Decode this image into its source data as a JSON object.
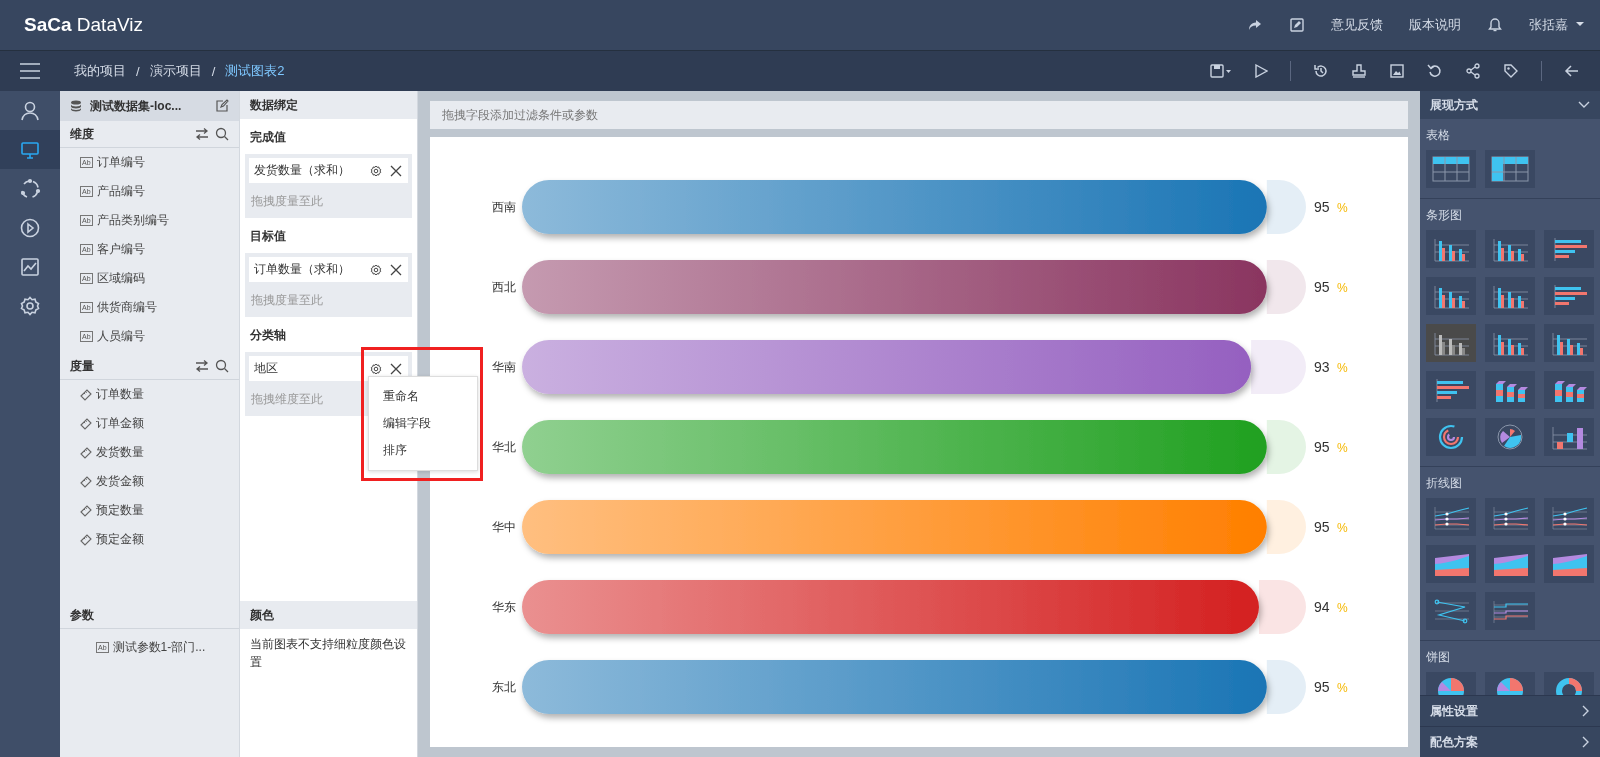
{
  "header": {
    "logo_mark": "SaCa",
    "logo_text": "DataViz",
    "links": [
      "意见反馈",
      "版本说明"
    ],
    "user": "张括嘉"
  },
  "breadcrumb": {
    "items": [
      {
        "label": "我的项目",
        "current": false
      },
      {
        "label": "演示项目",
        "current": false
      },
      {
        "label": "测试图表2",
        "current": true
      }
    ],
    "separators": [
      "/",
      "/"
    ]
  },
  "nav_rail": [
    {
      "kind": "user",
      "selected": false
    },
    {
      "kind": "monitor",
      "selected": true
    },
    {
      "kind": "cycle",
      "selected": false
    },
    {
      "kind": "play",
      "selected": false
    },
    {
      "kind": "trend",
      "selected": false
    },
    {
      "kind": "settings",
      "selected": false
    }
  ],
  "dataset": {
    "title": "测试数据集-loc..."
  },
  "dimensions": {
    "title": "维度",
    "items": [
      {
        "badge": "Ab",
        "label": "订单编号"
      },
      {
        "badge": "Ab",
        "label": "产品编号"
      },
      {
        "badge": "Ab",
        "label": "产品类别编号"
      },
      {
        "badge": "Ab",
        "label": "客户编号"
      },
      {
        "badge": "Ab",
        "label": "区域编码"
      },
      {
        "badge": "Ab",
        "label": "供货商编号"
      },
      {
        "badge": "Ab",
        "label": "人员编号"
      }
    ]
  },
  "measures": {
    "title": "度量",
    "items": [
      "订单数量",
      "订单金额",
      "发货数量",
      "发货金额",
      "预定数量",
      "预定金额"
    ]
  },
  "params": {
    "title": "参数",
    "items": [
      {
        "badge": "Ab",
        "label": "测试参数1-部门..."
      }
    ]
  },
  "binding": {
    "title": "数据绑定",
    "sections": [
      {
        "title": "完成值",
        "field": "发货数量（求和）",
        "hint": "拖拽度量至此"
      },
      {
        "title": "目标值",
        "field": "订单数量（求和）",
        "hint": "拖拽度量至此"
      },
      {
        "title": "分类轴",
        "field": "地区",
        "hint": "拖拽维度至此"
      }
    ],
    "menu": {
      "items": [
        "重命名",
        "编辑字段",
        "排序"
      ]
    },
    "color_title": "颜色",
    "color_note": "当前图表不支持细粒度颜色设置"
  },
  "filter_bar": {
    "placeholder": "拖拽字段添加过滤条件或参数"
  },
  "chart_data": {
    "type": "bar",
    "orientation": "horizontal",
    "categories": [
      "西南",
      "西北",
      "华南",
      "华北",
      "华中",
      "华东",
      "东北"
    ],
    "series": [
      {
        "values": [
          95,
          95,
          93,
          95,
          95,
          94,
          95
        ]
      }
    ],
    "xlim": [
      0,
      100
    ],
    "data_labels": true
  },
  "bar_styles": [
    {
      "color": "#1a75b5"
    },
    {
      "color": "#8a3560"
    },
    {
      "color": "#9560c0"
    },
    {
      "color": "#20a020"
    },
    {
      "color": "#ff7f00"
    },
    {
      "color": "#d42020"
    },
    {
      "color": "#1a75b5"
    }
  ],
  "percent_signs": [
    "%",
    "%",
    "%",
    "%",
    "%",
    "%",
    "%"
  ],
  "display_panel": {
    "title": "展现方式",
    "groups": [
      {
        "title": "表格",
        "items": [
          {
            "kind": "table",
            "selected": false
          },
          {
            "kind": "pivot",
            "selected": false
          }
        ]
      },
      {
        "title": "条形图",
        "items": [
          {
            "kind": "bar",
            "selected": false
          },
          {
            "kind": "bar",
            "selected": false
          },
          {
            "kind": "hbar",
            "selected": false
          },
          {
            "kind": "bar",
            "selected": false
          },
          {
            "kind": "bar",
            "selected": false
          },
          {
            "kind": "hbar",
            "selected": false
          },
          {
            "kind": "bar",
            "selected": true
          },
          {
            "kind": "bar",
            "selected": false
          },
          {
            "kind": "bar",
            "selected": false
          },
          {
            "kind": "hbar",
            "selected": false
          },
          {
            "kind": "bar3d",
            "selected": false
          },
          {
            "kind": "bar3d",
            "selected": false
          },
          {
            "kind": "ring",
            "selected": false
          },
          {
            "kind": "polar",
            "selected": false
          },
          {
            "kind": "waterfall",
            "selected": false
          }
        ]
      },
      {
        "title": "折线图",
        "items": [
          {
            "kind": "line",
            "selected": false
          },
          {
            "kind": "line",
            "selected": false
          },
          {
            "kind": "line",
            "selected": false
          },
          {
            "kind": "area",
            "selected": false
          },
          {
            "kind": "area",
            "selected": false
          },
          {
            "kind": "area",
            "selected": false
          },
          {
            "kind": "zigzag",
            "selected": false
          },
          {
            "kind": "step",
            "selected": false
          }
        ]
      },
      {
        "title": "饼图",
        "items": [
          {
            "kind": "pie",
            "selected": false
          },
          {
            "kind": "pie",
            "selected": false
          },
          {
            "kind": "donut",
            "selected": false
          }
        ]
      }
    ],
    "footer": [
      "属性设置",
      "配色方案"
    ]
  }
}
